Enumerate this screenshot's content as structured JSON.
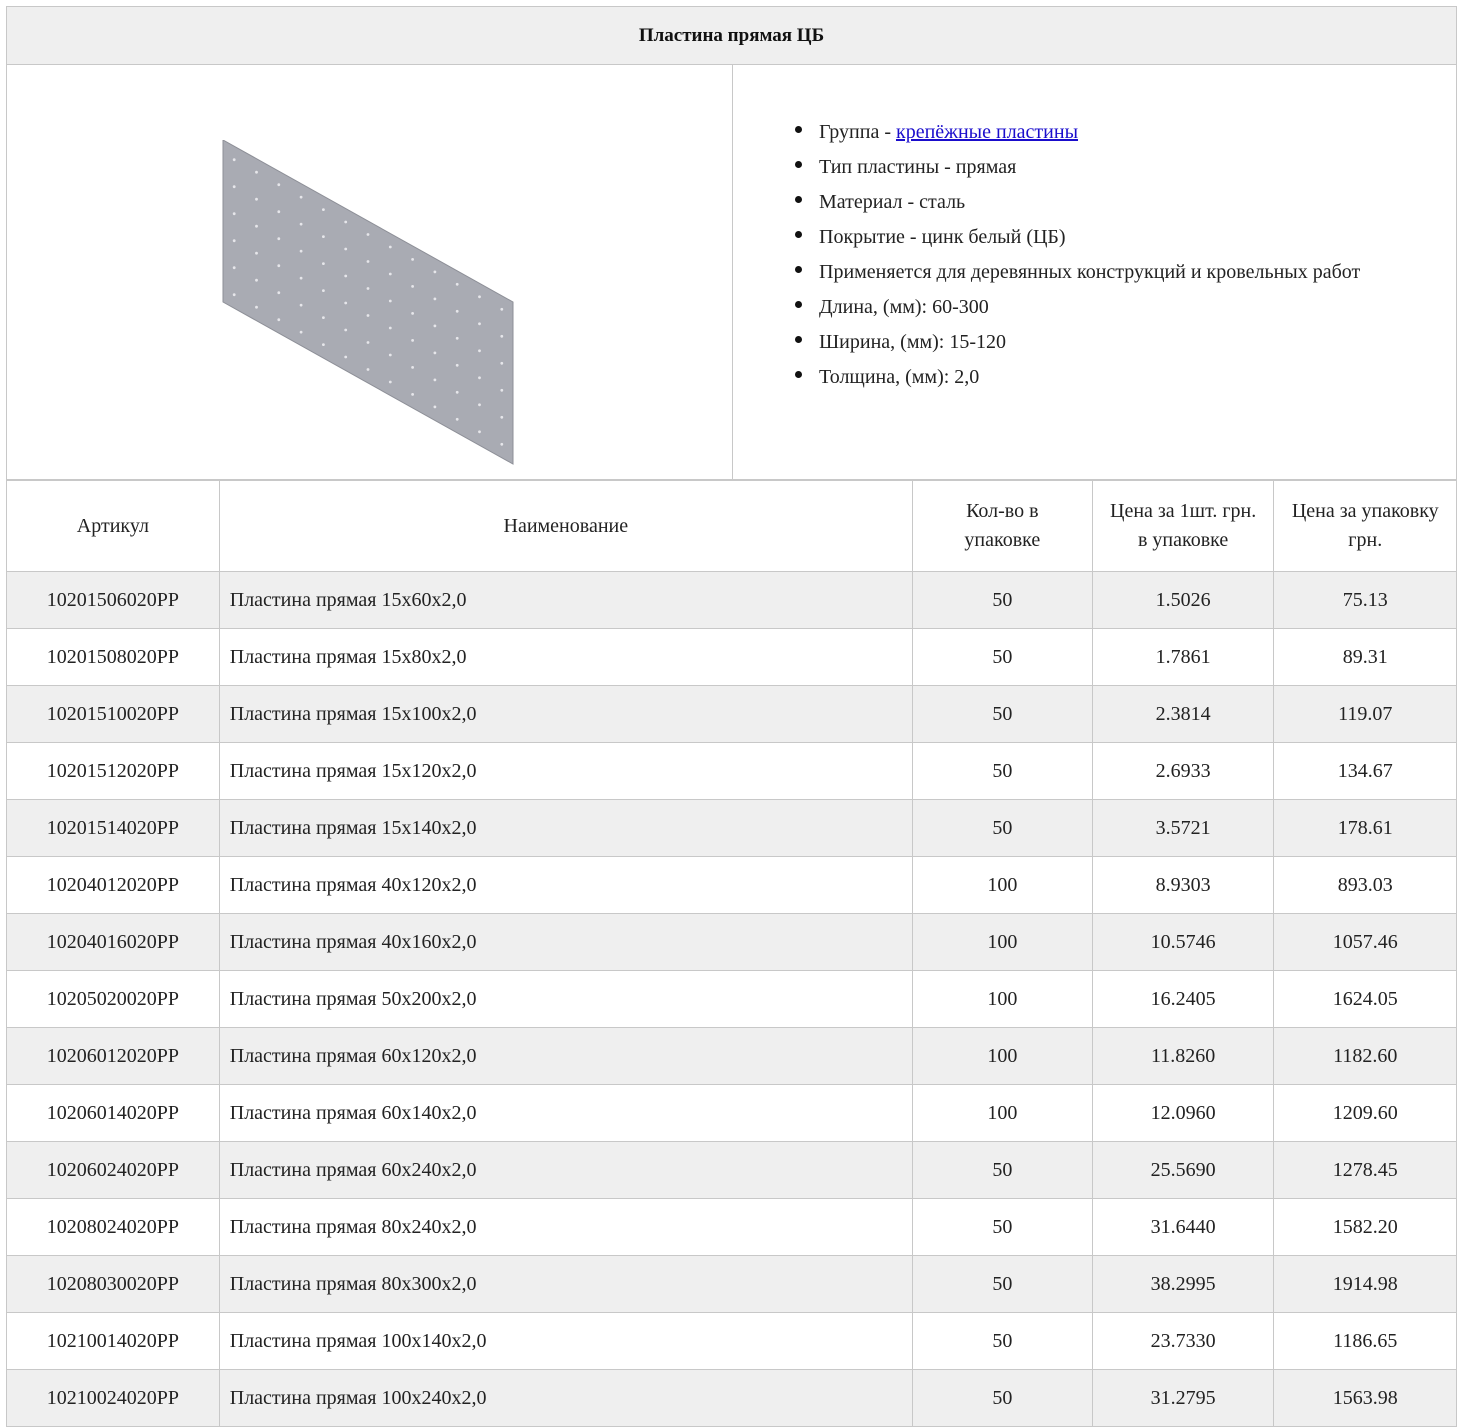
{
  "page": {
    "title": "Пластина прямая ЦБ"
  },
  "product_image": {
    "icon": "perforated-plate-image",
    "colors": {
      "plate": "#a9abb3",
      "edge": "#7d7f87",
      "holes": "#e6e6ea"
    }
  },
  "specs": {
    "group_label": "Группа - ",
    "group_link": "крепёжные пластины",
    "items": [
      "Тип пластины - прямая",
      "Материал - сталь",
      "Покрытие - цинк белый (ЦБ)",
      "Применяется для деревянных конструкций и кровельных работ",
      "Длина, (мм): 60-300",
      "Ширина, (мм): 15-120",
      "Толщина, (мм): 2,0"
    ]
  },
  "table": {
    "headers": {
      "sku": "Артикул",
      "name": "Наименование",
      "qty": "Кол-во в упаковке",
      "unit_price": "Цена за 1шт. грн. в упаковке",
      "pack_price": "Цена за упаковку грн."
    },
    "rows": [
      {
        "sku": "10201506020PP",
        "name": "Пластина прямая 15x60x2,0",
        "qty": "50",
        "unit_price": "1.5026",
        "pack_price": "75.13"
      },
      {
        "sku": "10201508020PP",
        "name": "Пластина прямая 15x80x2,0",
        "qty": "50",
        "unit_price": "1.7861",
        "pack_price": "89.31"
      },
      {
        "sku": "10201510020PP",
        "name": "Пластина прямая 15x100x2,0",
        "qty": "50",
        "unit_price": "2.3814",
        "pack_price": "119.07"
      },
      {
        "sku": "10201512020PP",
        "name": "Пластина прямая 15x120x2,0",
        "qty": "50",
        "unit_price": "2.6933",
        "pack_price": "134.67"
      },
      {
        "sku": "10201514020PP",
        "name": "Пластина прямая 15x140x2,0",
        "qty": "50",
        "unit_price": "3.5721",
        "pack_price": "178.61"
      },
      {
        "sku": "10204012020PP",
        "name": "Пластина прямая 40x120x2,0",
        "qty": "100",
        "unit_price": "8.9303",
        "pack_price": "893.03"
      },
      {
        "sku": "10204016020PP",
        "name": "Пластина прямая 40x160x2,0",
        "qty": "100",
        "unit_price": "10.5746",
        "pack_price": "1057.46"
      },
      {
        "sku": "10205020020PP",
        "name": "Пластина прямая 50x200x2,0",
        "qty": "100",
        "unit_price": "16.2405",
        "pack_price": "1624.05"
      },
      {
        "sku": "10206012020PP",
        "name": "Пластина прямая 60x120x2,0",
        "qty": "100",
        "unit_price": "11.8260",
        "pack_price": "1182.60"
      },
      {
        "sku": "10206014020PP",
        "name": "Пластина прямая 60x140x2,0",
        "qty": "100",
        "unit_price": "12.0960",
        "pack_price": "1209.60"
      },
      {
        "sku": "10206024020PP",
        "name": "Пластина прямая 60x240x2,0",
        "qty": "50",
        "unit_price": "25.5690",
        "pack_price": "1278.45"
      },
      {
        "sku": "10208024020PP",
        "name": "Пластина прямая 80x240x2,0",
        "qty": "50",
        "unit_price": "31.6440",
        "pack_price": "1582.20"
      },
      {
        "sku": "10208030020PP",
        "name": "Пластина прямая 80x300x2,0",
        "qty": "50",
        "unit_price": "38.2995",
        "pack_price": "1914.98"
      },
      {
        "sku": "10210014020PP",
        "name": "Пластина прямая 100x140x2,0",
        "qty": "50",
        "unit_price": "23.7330",
        "pack_price": "1186.65"
      },
      {
        "sku": "10210024020PP",
        "name": "Пластина прямая 100x240x2,0",
        "qty": "50",
        "unit_price": "31.2795",
        "pack_price": "1563.98"
      }
    ]
  }
}
